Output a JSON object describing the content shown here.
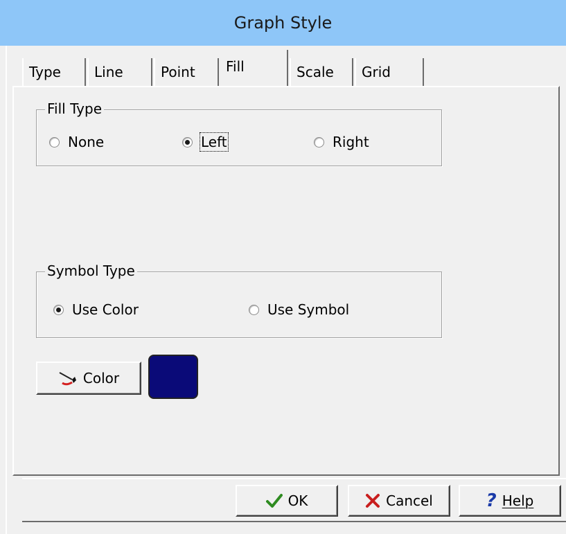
{
  "window": {
    "title": "Graph Style"
  },
  "tabs": [
    {
      "label": "Type",
      "active": false
    },
    {
      "label": "Line",
      "active": false
    },
    {
      "label": "Point",
      "active": false
    },
    {
      "label": "Fill",
      "active": true
    },
    {
      "label": "Scale",
      "active": false
    },
    {
      "label": "Grid",
      "active": false
    }
  ],
  "fill_type": {
    "title": "Fill Type",
    "options": [
      {
        "label": "None",
        "selected": false
      },
      {
        "label": "Left",
        "selected": true
      },
      {
        "label": "Right",
        "selected": false
      }
    ]
  },
  "symbol_type": {
    "title": "Symbol Type",
    "options": [
      {
        "label": "Use Color",
        "selected": true
      },
      {
        "label": "Use Symbol",
        "selected": false
      }
    ]
  },
  "color_button": {
    "label": "Color",
    "icon": "paint-brush-icon"
  },
  "color_swatch": {
    "value": "#0a0a78"
  },
  "buttons": {
    "ok": {
      "label": "OK",
      "icon": "checkmark-icon"
    },
    "cancel": {
      "label": "Cancel",
      "icon": "x-icon"
    },
    "help": {
      "label": "Help",
      "icon": "question-icon"
    }
  },
  "colors": {
    "titlebar": "#8ec6f8",
    "ok_icon": "#2e8b20",
    "cancel_icon": "#c81e1e",
    "help_icon": "#1a3aa8"
  }
}
